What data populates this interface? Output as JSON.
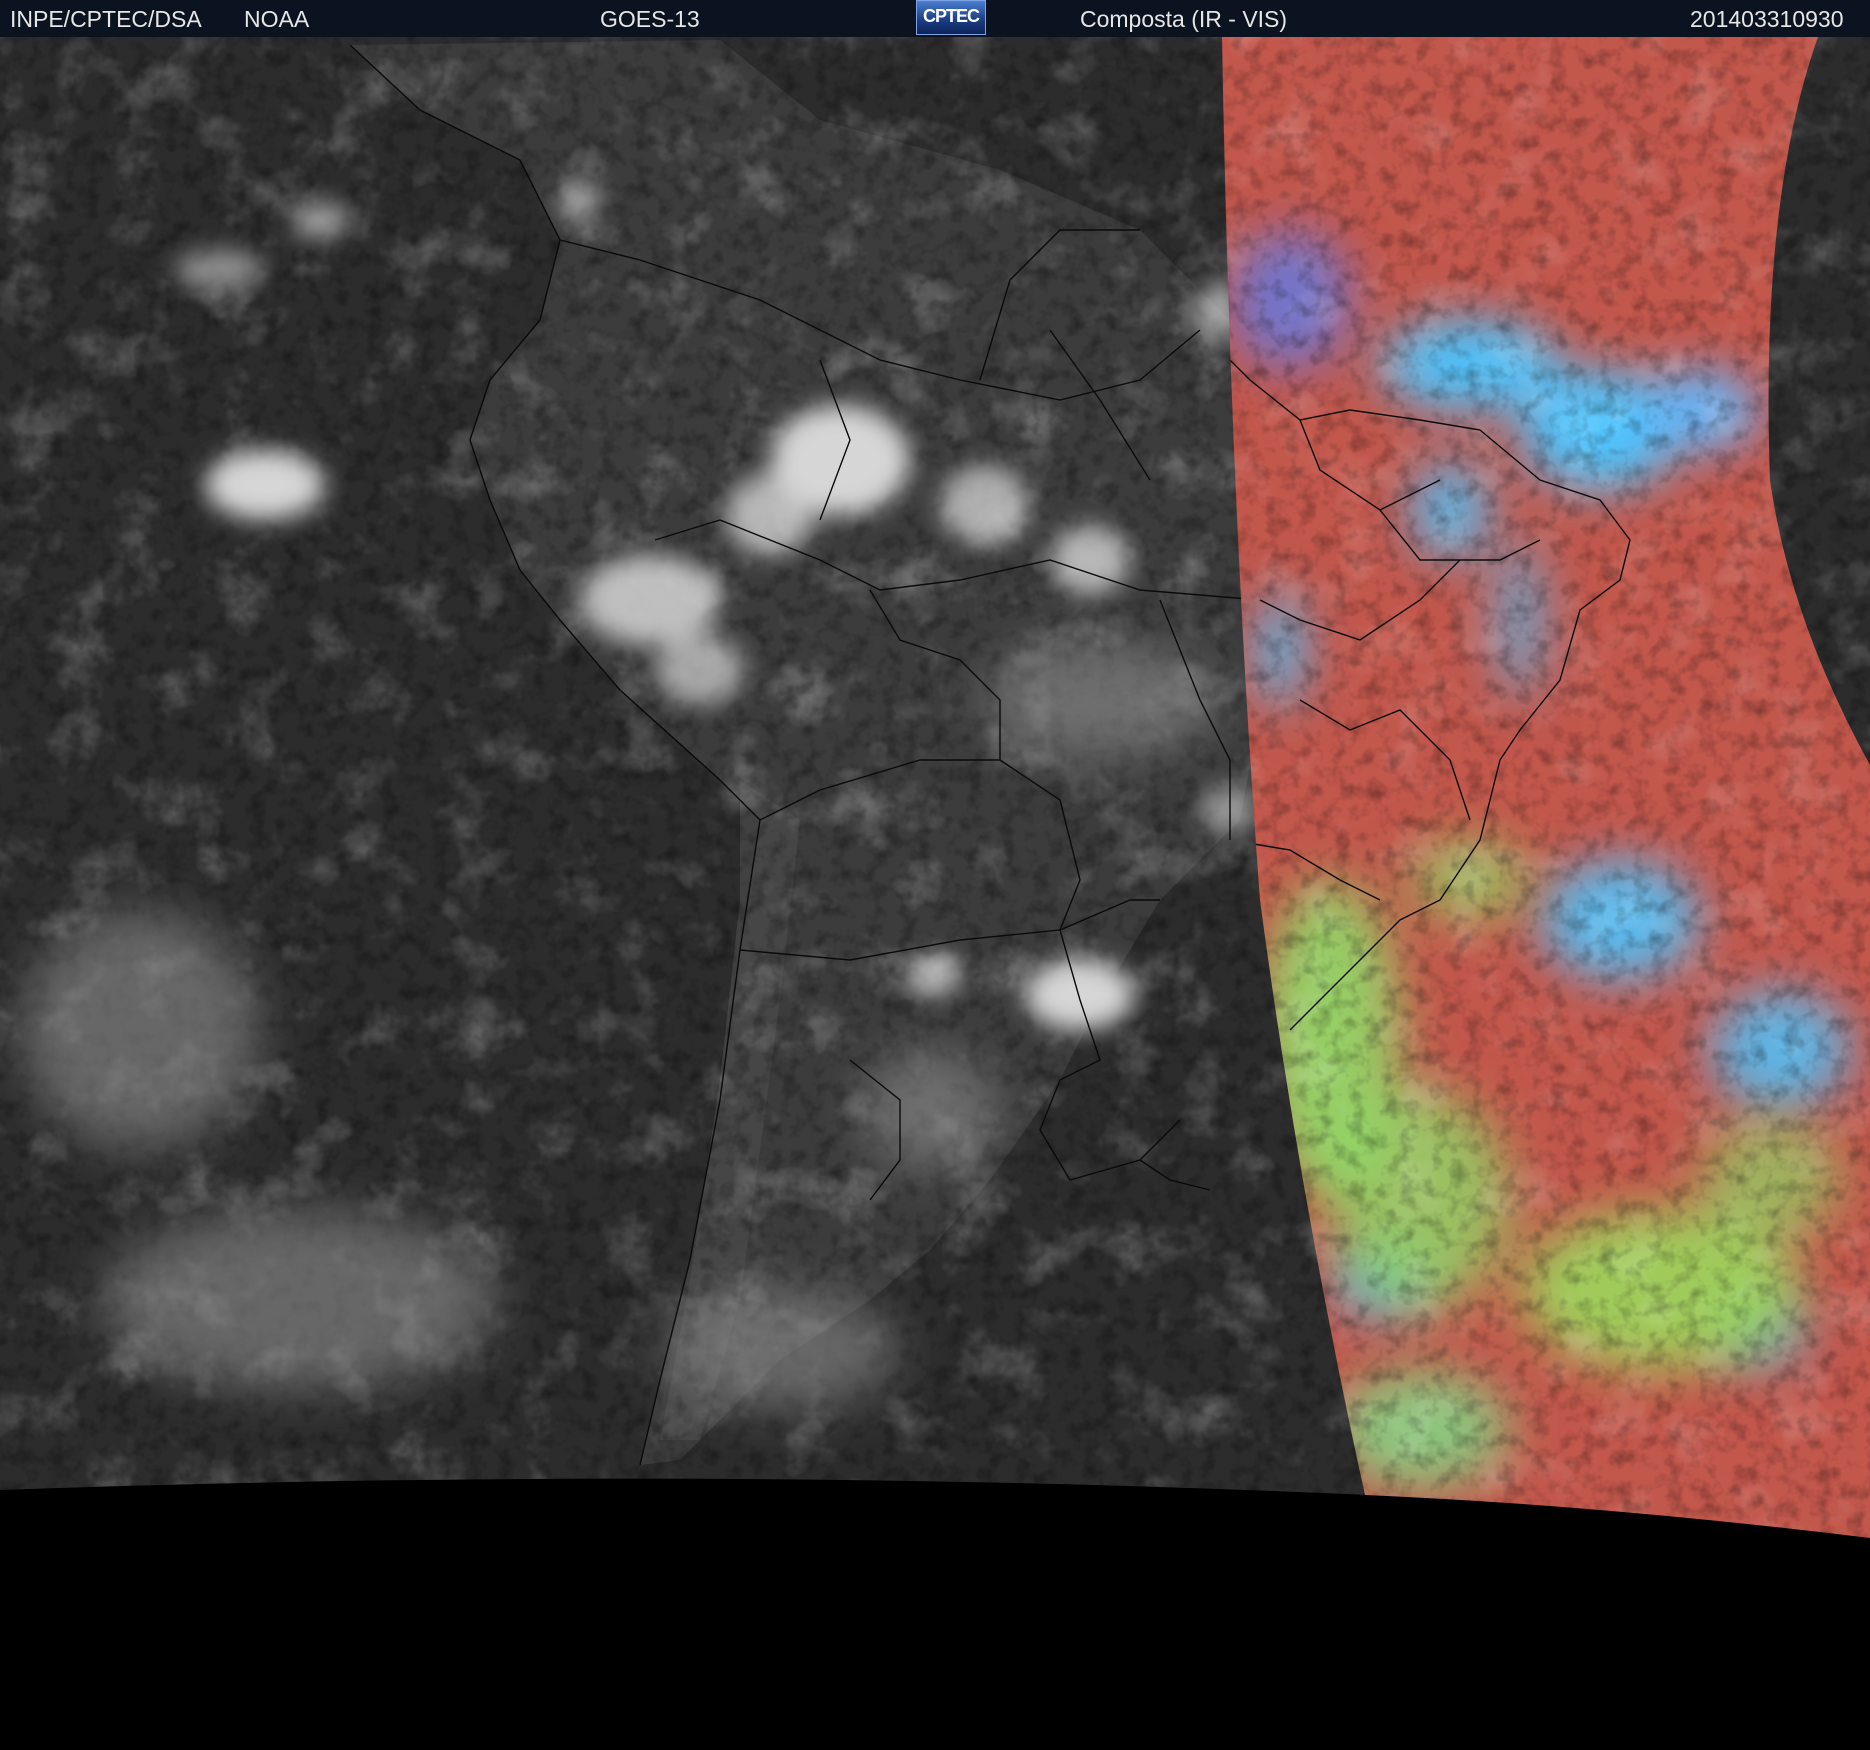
{
  "header": {
    "institution": "INPE/CPTEC/DSA",
    "agency": "NOAA",
    "satellite": "GOES-13",
    "logo_text": "CPTEC",
    "product": "Composta (IR - VIS)",
    "timestamp": "201403310930"
  },
  "colors": {
    "header_background": "#0c1320",
    "header_text": "#e6e6e6",
    "ir_land_gray": "#3e3e3e",
    "ocean_gray": "#2c2c2c",
    "cloud_white": "#d8d8d8",
    "composite_red": "#c2574c",
    "composite_cyan": "#4cc4ff",
    "composite_green": "#8ee26a",
    "border_lines": "#0a0a0a",
    "space_black": "#000000"
  }
}
